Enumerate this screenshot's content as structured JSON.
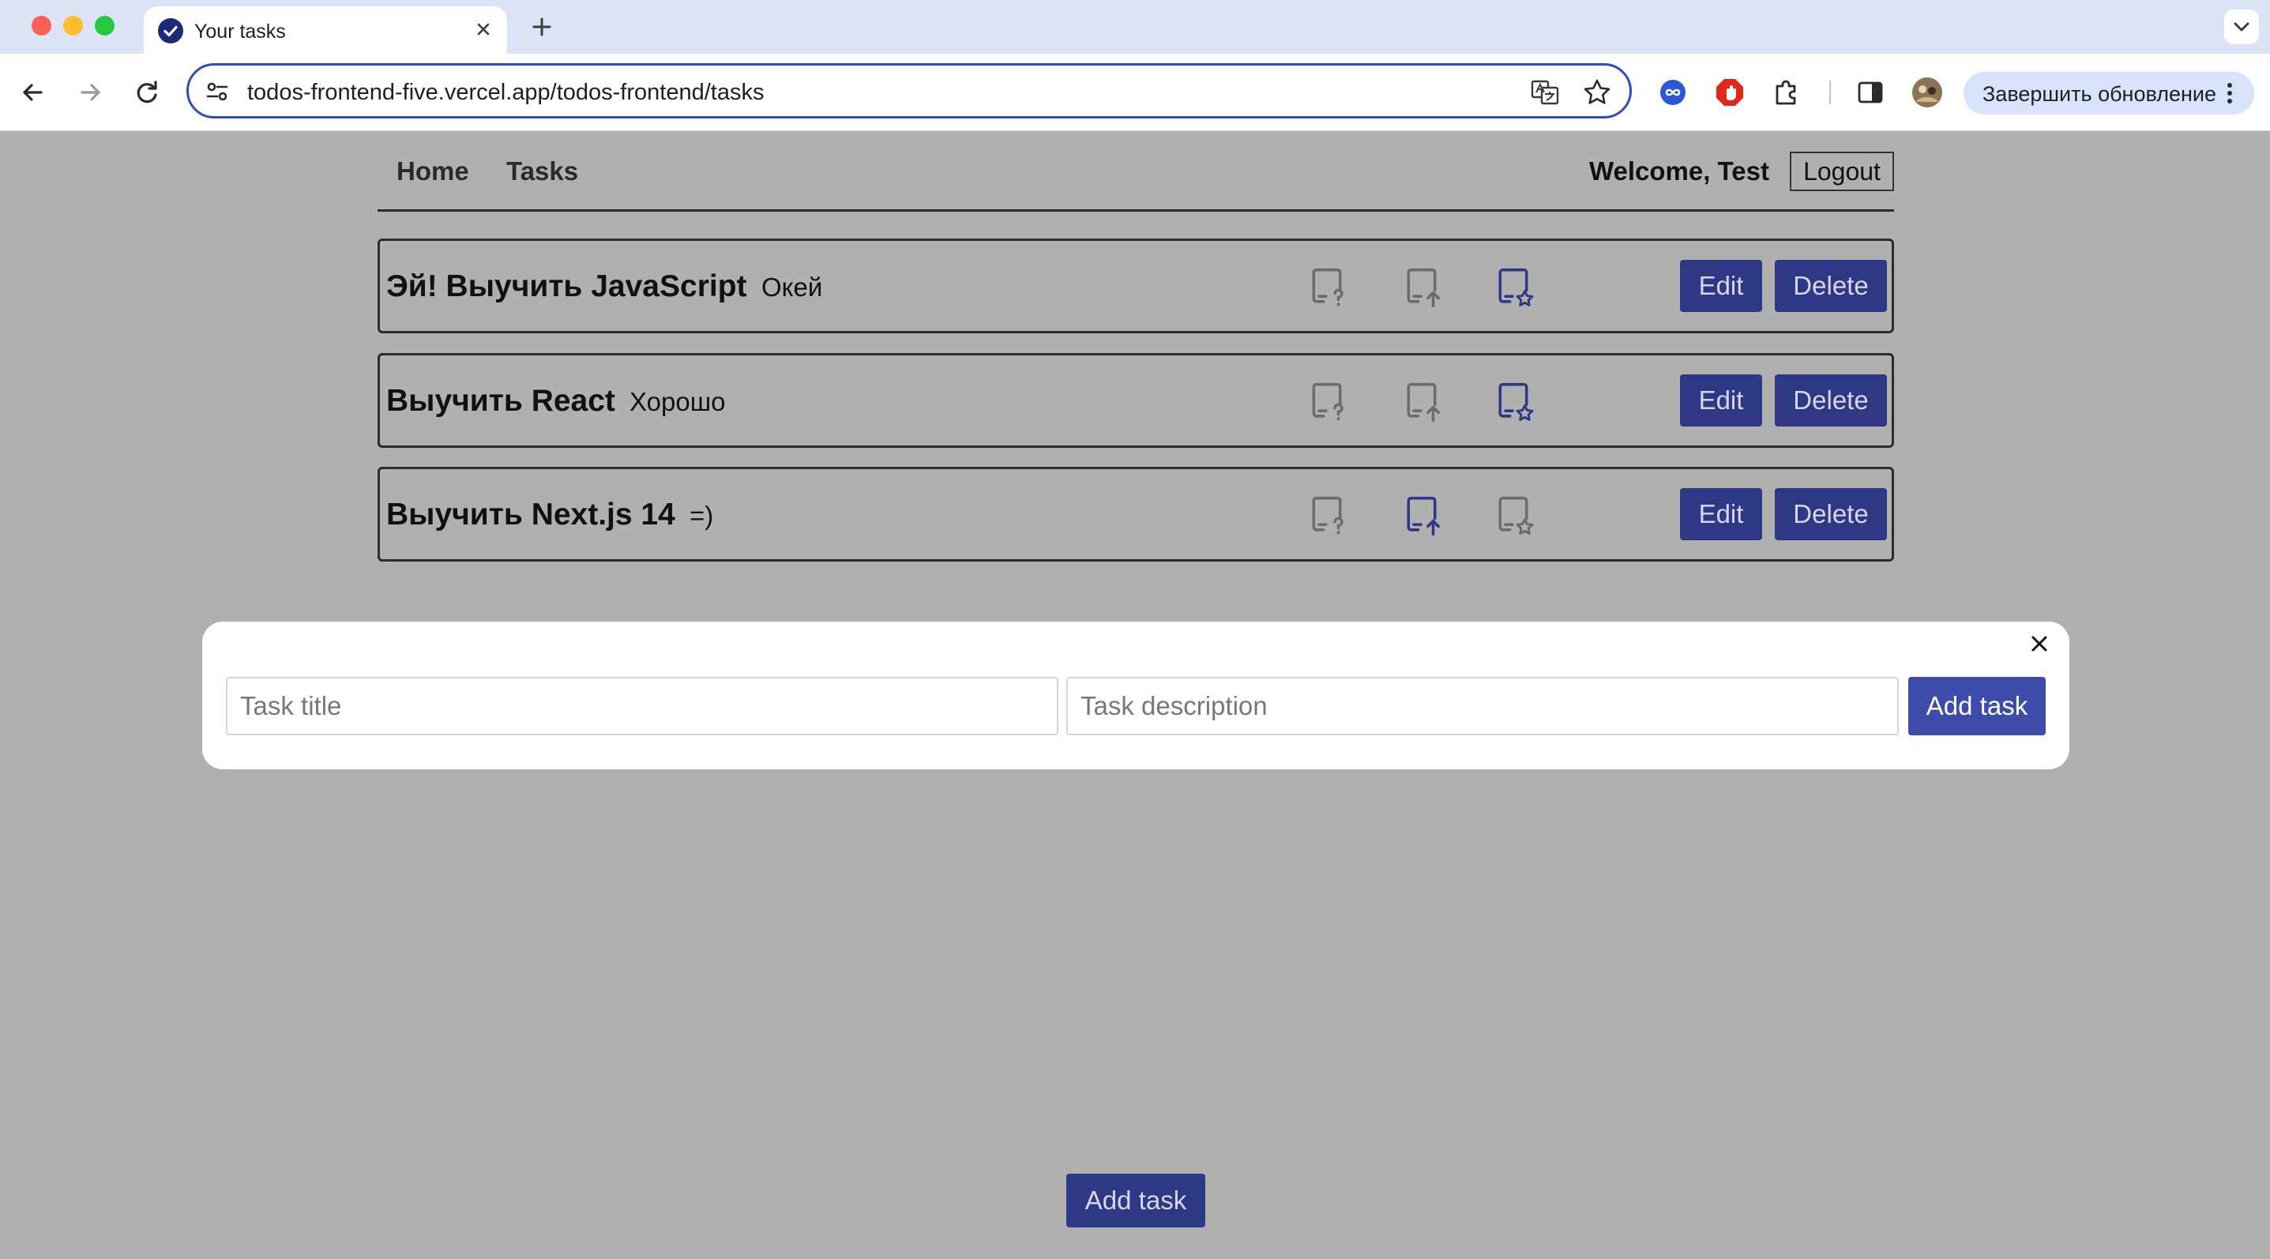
{
  "browser": {
    "tab_title": "Your tasks",
    "url": "todos-frontend-five.vercel.app/todos-frontend/tasks",
    "update_label": "Завершить обновление"
  },
  "nav": {
    "home": "Home",
    "tasks": "Tasks",
    "welcome": "Welcome, Test",
    "logout": "Logout"
  },
  "tasks": [
    {
      "title": "Эй! Выучить JavaScript",
      "description": "Окей",
      "active_status": "favorite",
      "edit": "Edit",
      "delete": "Delete"
    },
    {
      "title": "Выучить React",
      "description": "Хорошо",
      "active_status": "favorite",
      "edit": "Edit",
      "delete": "Delete"
    },
    {
      "title": "Выучить Next.js 14",
      "description": "=)",
      "active_status": "in-progress",
      "edit": "Edit",
      "delete": "Delete"
    }
  ],
  "modal": {
    "title_placeholder": "Task title",
    "description_placeholder": "Task description",
    "add_label": "Add task"
  },
  "footer": {
    "add_label": "Add task"
  },
  "colors": {
    "accent": "#2e3884",
    "accent_light": "#3d4bab",
    "overlay": "#b0b0b0",
    "icon_inactive": "#6b6b6b"
  },
  "icons": {
    "status": [
      "tablet-question-icon",
      "tablet-upload-icon",
      "tablet-star-icon"
    ]
  }
}
